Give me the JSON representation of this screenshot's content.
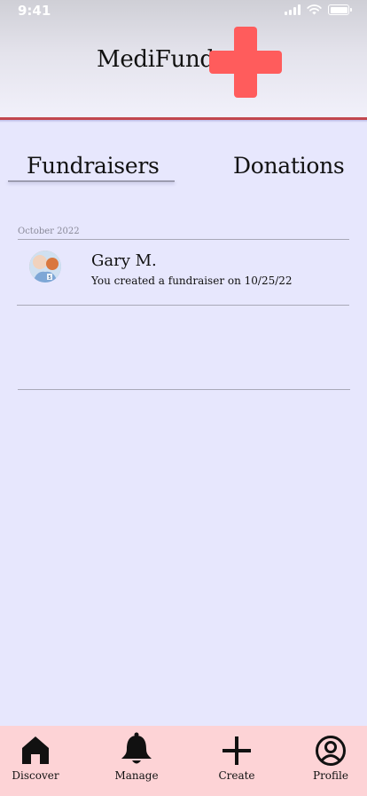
{
  "status_bar": {
    "time": "9:41"
  },
  "header": {
    "app_title": "MediFund",
    "logo_icon": "red-cross-icon",
    "logo_color": "#ff5c5c",
    "rule_color": "#c2474f"
  },
  "tabs": [
    {
      "label": "Fundraisers",
      "selected": true
    },
    {
      "label": "Donations",
      "selected": false
    }
  ],
  "activity": {
    "sections": [
      {
        "date_label": "October 2022",
        "items": [
          {
            "avatar_icon": "user-avatar-photo",
            "name": "Gary M.",
            "description": "You created a fundraiser on 10/25/22"
          }
        ]
      }
    ]
  },
  "bottom_nav": {
    "background": "#fdd3d6",
    "items": [
      {
        "label": "Discover",
        "icon": "home-icon"
      },
      {
        "label": "Manage",
        "icon": "bell-icon"
      },
      {
        "label": "Create",
        "icon": "plus-icon"
      },
      {
        "label": "Profile",
        "icon": "profile-icon"
      }
    ]
  }
}
